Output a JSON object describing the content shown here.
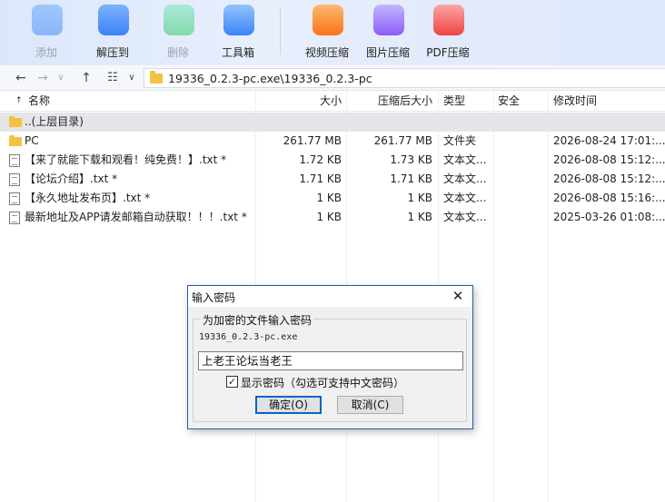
{
  "toolbar": {
    "items": [
      {
        "label": "添加",
        "icon": "add-archive-icon",
        "enabled": false,
        "color": "#3b82f6"
      },
      {
        "label": "解压到",
        "icon": "extract-icon",
        "enabled": true,
        "color": "#3b82f6"
      },
      {
        "label": "删除",
        "icon": "recycle-icon",
        "enabled": false,
        "color": "#22c55e"
      },
      {
        "label": "工具箱",
        "icon": "toolbox-icon",
        "enabled": true,
        "color": "#3b82f6"
      },
      {
        "label": "视频压缩",
        "icon": "video-compress-icon",
        "enabled": true,
        "color": "#f97316"
      },
      {
        "label": "图片压缩",
        "icon": "image-compress-icon",
        "enabled": true,
        "color": "#8b5cf6"
      },
      {
        "label": "PDF压缩",
        "icon": "pdf-compress-icon",
        "enabled": true,
        "color": "#ef4444"
      }
    ]
  },
  "address": {
    "path": "19336_0.2.3-pc.exe\\19336_0.2.3-pc"
  },
  "columns": {
    "name": "名称",
    "size": "大小",
    "packed": "压缩后大小",
    "type": "类型",
    "security": "安全",
    "modified": "修改时间"
  },
  "rows": [
    {
      "name": "..(上层目录)",
      "size": "",
      "packed": "",
      "type": "",
      "modified": "",
      "kind": "folder",
      "parent": true
    },
    {
      "name": "PC",
      "size": "261.77 MB",
      "packed": "261.77 MB",
      "type": "文件夹",
      "modified": "2026-08-24 17:01:...",
      "kind": "folder"
    },
    {
      "name": "【来了就能下载和观看！纯免费！】.txt *",
      "size": "1.72 KB",
      "packed": "1.73 KB",
      "type": "文本文...",
      "modified": "2026-08-08 15:12:...",
      "kind": "txt"
    },
    {
      "name": "【论坛介绍】.txt *",
      "size": "1.71 KB",
      "packed": "1.71 KB",
      "type": "文本文...",
      "modified": "2026-08-08 15:12:...",
      "kind": "txt"
    },
    {
      "name": "【永久地址发布页】.txt *",
      "size": "1 KB",
      "packed": "1 KB",
      "type": "文本文...",
      "modified": "2026-08-08 15:16:...",
      "kind": "txt"
    },
    {
      "name": "最新地址及APP请发邮箱自动获取！！！.txt *",
      "size": "1 KB",
      "packed": "1 KB",
      "type": "文本文...",
      "modified": "2025-03-26 01:08:...",
      "kind": "txt"
    }
  ],
  "dialog": {
    "title": "输入密码",
    "close": "✕",
    "group_label": "为加密的文件输入密码",
    "filename": "19336_0.2.3-pc.exe",
    "password_value": "上老王论坛当老王",
    "show_password_checked": true,
    "show_password_label": "显示密码（勾选可支持中文密码）",
    "ok_label": "确定(O)",
    "cancel_label": "取消(C)"
  }
}
